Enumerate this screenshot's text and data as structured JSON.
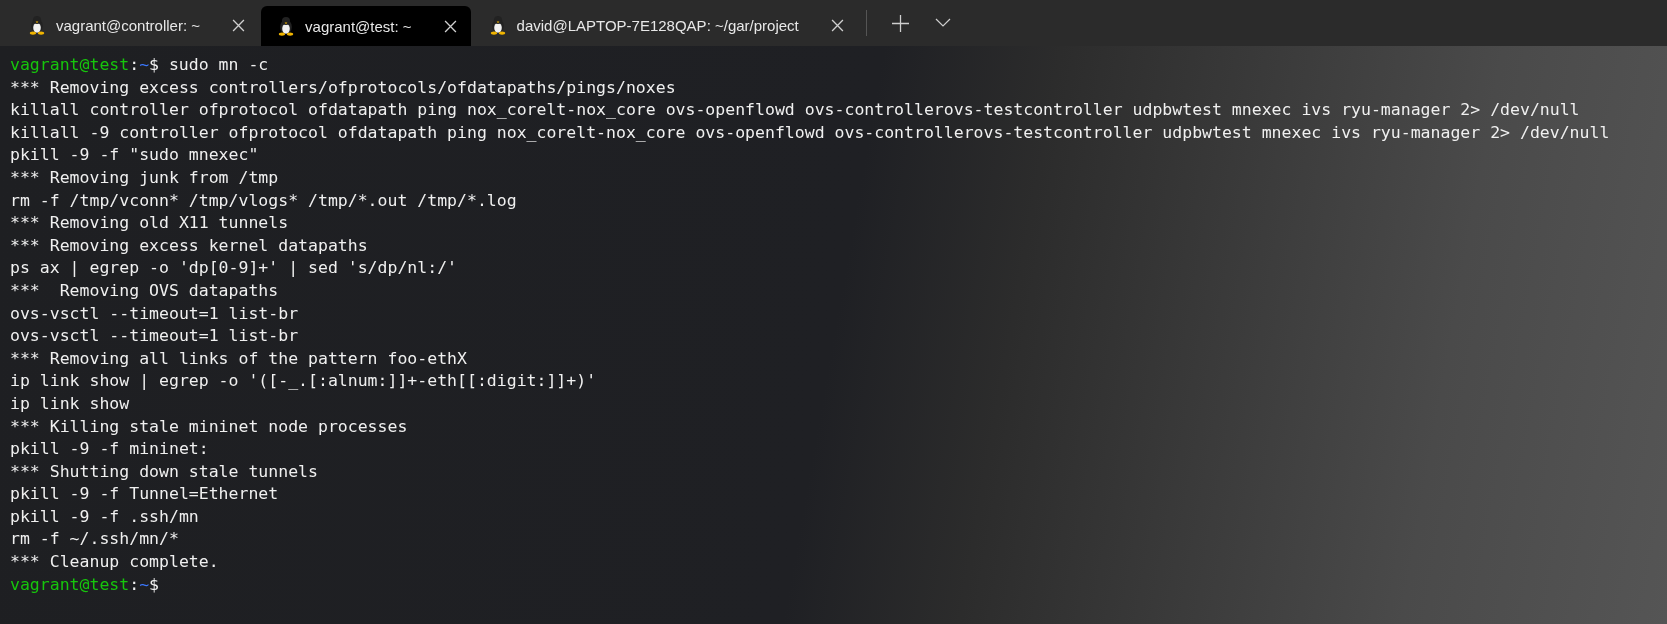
{
  "tabs": [
    {
      "title": "vagrant@controller: ~",
      "selected": false
    },
    {
      "title": "vagrant@test: ~",
      "selected": true
    },
    {
      "title": "david@LAPTOP-7E128QAP: ~/gar/project",
      "selected": false
    }
  ],
  "lines": [
    {
      "kind": "prompt",
      "user_host": "vagrant@test",
      "separator": ":",
      "path": "~",
      "symbol": "$",
      "command": "sudo mn -c"
    },
    {
      "kind": "output",
      "text": "*** Removing excess controllers/ofprotocols/ofdatapaths/pings/noxes"
    },
    {
      "kind": "output",
      "text": "killall controller ofprotocol ofdatapath ping nox_corelt-nox_core ovs-openflowd ovs-controllerovs-testcontroller udpbwtest mnexec ivs ryu-manager 2> /dev/null"
    },
    {
      "kind": "output",
      "text": "killall -9 controller ofprotocol ofdatapath ping nox_corelt-nox_core ovs-openflowd ovs-controllerovs-testcontroller udpbwtest mnexec ivs ryu-manager 2> /dev/null"
    },
    {
      "kind": "output",
      "text": "pkill -9 -f \"sudo mnexec\""
    },
    {
      "kind": "output",
      "text": "*** Removing junk from /tmp"
    },
    {
      "kind": "output",
      "text": "rm -f /tmp/vconn* /tmp/vlogs* /tmp/*.out /tmp/*.log"
    },
    {
      "kind": "output",
      "text": "*** Removing old X11 tunnels"
    },
    {
      "kind": "output",
      "text": "*** Removing excess kernel datapaths"
    },
    {
      "kind": "output",
      "text": "ps ax | egrep -o 'dp[0-9]+' | sed 's/dp/nl:/'"
    },
    {
      "kind": "output",
      "text": "***  Removing OVS datapaths"
    },
    {
      "kind": "output",
      "text": "ovs-vsctl --timeout=1 list-br"
    },
    {
      "kind": "output",
      "text": "ovs-vsctl --timeout=1 list-br"
    },
    {
      "kind": "output",
      "text": "*** Removing all links of the pattern foo-ethX"
    },
    {
      "kind": "output",
      "text": "ip link show | egrep -o '([-_.[:alnum:]]+-eth[[:digit:]]+)'"
    },
    {
      "kind": "output",
      "text": "ip link show"
    },
    {
      "kind": "output",
      "text": "*** Killing stale mininet node processes"
    },
    {
      "kind": "output",
      "text": "pkill -9 -f mininet:"
    },
    {
      "kind": "output",
      "text": "*** Shutting down stale tunnels"
    },
    {
      "kind": "output",
      "text": "pkill -9 -f Tunnel=Ethernet"
    },
    {
      "kind": "output",
      "text": "pkill -9 -f .ssh/mn"
    },
    {
      "kind": "output",
      "text": "rm -f ~/.ssh/mn/*"
    },
    {
      "kind": "output",
      "text": "*** Cleanup complete."
    },
    {
      "kind": "prompt",
      "user_host": "vagrant@test",
      "separator": ":",
      "path": "~",
      "symbol": "$"
    }
  ]
}
